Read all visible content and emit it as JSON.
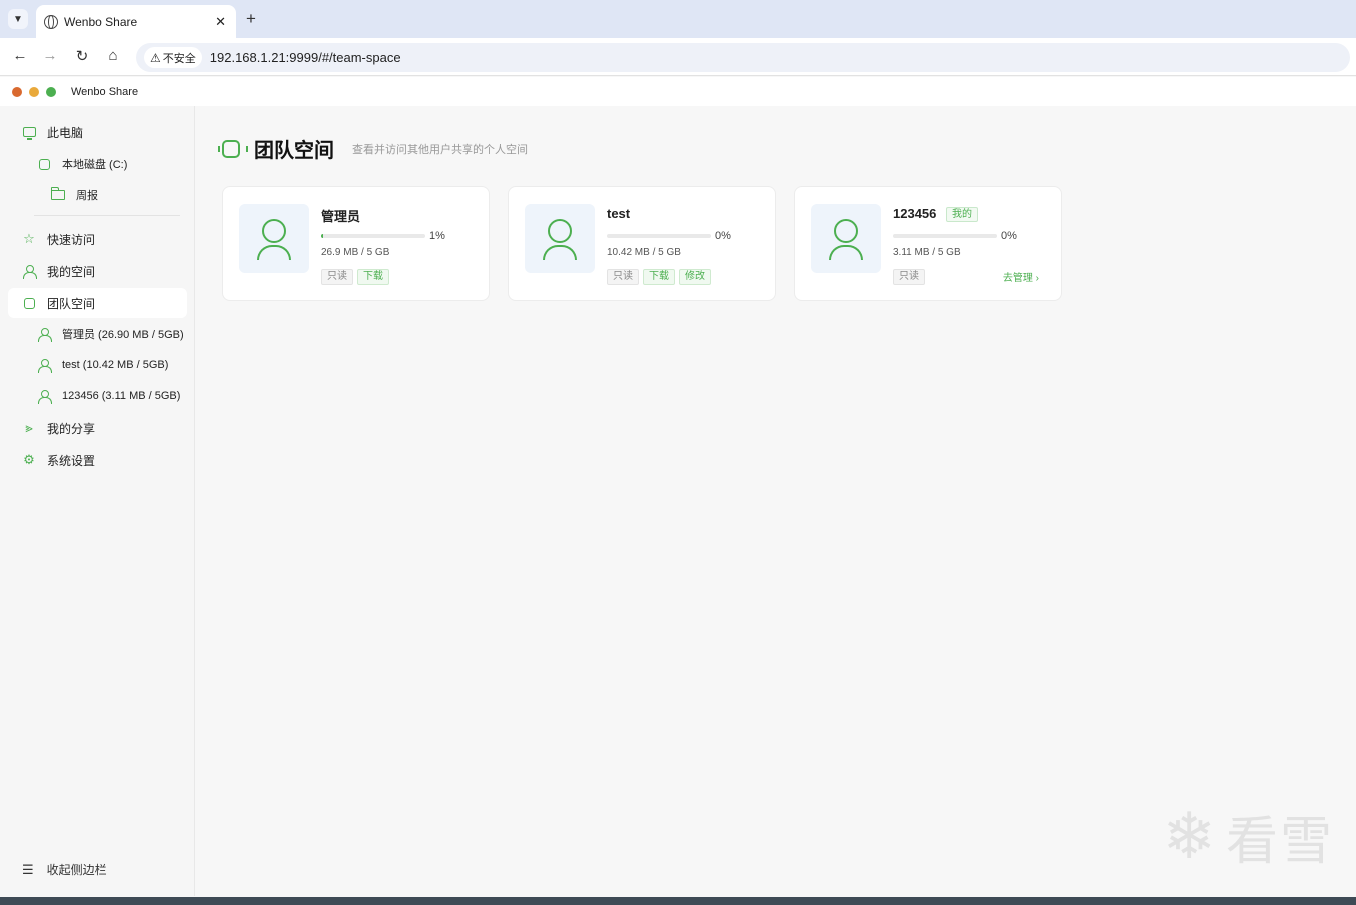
{
  "browser": {
    "tab_title": "Wenbo Share",
    "tab_close": "✕",
    "new_tab": "+",
    "insecure_label": "不安全",
    "url": "192.168.1.21:9999/#/team-space"
  },
  "app": {
    "title": "Wenbo Share",
    "window_dots": [
      "#d9692f",
      "#e9a93b",
      "#4caf50"
    ]
  },
  "sidebar": {
    "this_pc": "此电脑",
    "local_disk": "本地磁盘 (C:)",
    "folder_weekly": "周报",
    "quick_access": "快速访问",
    "my_space": "我的空间",
    "team_space": "团队空间",
    "team_users": [
      "管理员 (26.90 MB / 5GB)",
      "test (10.42 MB / 5GB)",
      "123456 (3.11 MB / 5GB)"
    ],
    "my_share": "我的分享",
    "settings": "系统设置",
    "collapse": "收起侧边栏"
  },
  "main": {
    "title": "团队空间",
    "subtitle": "查看并访问其他用户共享的个人空间",
    "cards": [
      {
        "name": "管理员",
        "percent_label": "1%",
        "usage_fraction": 0.01,
        "size": "26.9 MB / 5 GB",
        "tags": [
          {
            "label": "只读",
            "style": "grey"
          },
          {
            "label": "下载",
            "style": "green"
          }
        ]
      },
      {
        "name": "test",
        "percent_label": "0%",
        "usage_fraction": 0.0,
        "size": "10.42 MB / 5 GB",
        "tags": [
          {
            "label": "只读",
            "style": "grey"
          },
          {
            "label": "下载",
            "style": "green"
          },
          {
            "label": "修改",
            "style": "green"
          }
        ]
      },
      {
        "name": "123456",
        "mine_badge": "我的",
        "percent_label": "0%",
        "usage_fraction": 0.0,
        "size": "3.11 MB / 5 GB",
        "tags": [
          {
            "label": "只读",
            "style": "grey"
          }
        ],
        "manage_link": "去管理 ›"
      }
    ]
  },
  "watermark": {
    "text": "看雪"
  },
  "colors": {
    "accent": "#4caf50"
  }
}
